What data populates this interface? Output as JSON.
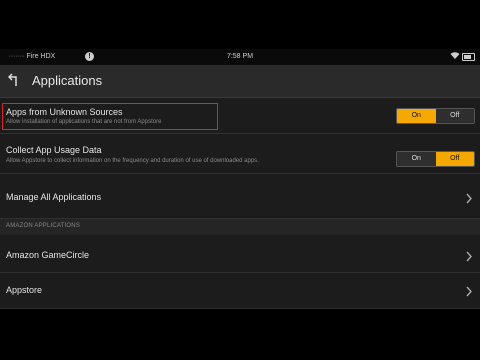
{
  "status": {
    "device_prefix": "·········",
    "device_name": "Fire HDX",
    "alert_icon": "!",
    "time": "7:58 PM"
  },
  "header": {
    "title": "Applications"
  },
  "settings": {
    "unknown_sources": {
      "label": "Apps from Unknown Sources",
      "desc": "Allow installation of applications that are not from Appstore",
      "on_label": "On",
      "off_label": "Off",
      "selected": "On"
    },
    "usage_data": {
      "label": "Collect App Usage Data",
      "desc": "Allow Appstore to collect information on the frequency and duration of use of downloaded apps.",
      "on_label": "On",
      "off_label": "Off",
      "selected": "Off"
    },
    "manage_all": {
      "label": "Manage All Applications"
    }
  },
  "amazon_section": {
    "header": "AMAZON APPLICATIONS",
    "items": [
      {
        "label": "Amazon GameCircle"
      },
      {
        "label": "Appstore"
      }
    ]
  },
  "colors": {
    "accent": "#f5a800",
    "highlight_border": "#d4292a",
    "background": "#1c1c1c"
  }
}
